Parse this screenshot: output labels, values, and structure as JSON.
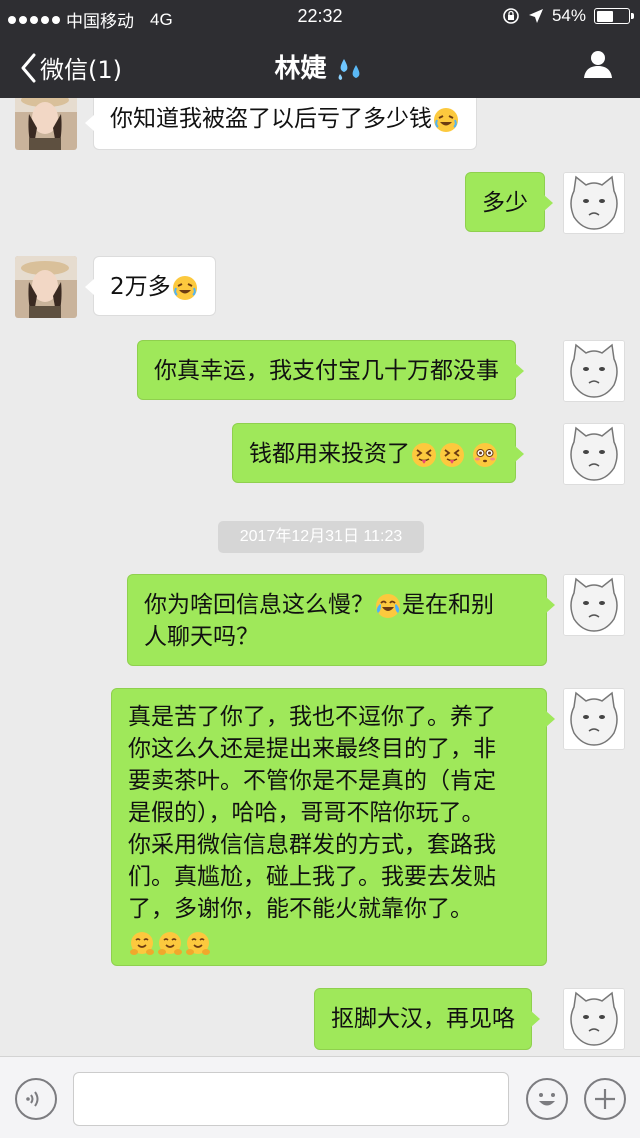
{
  "status_bar": {
    "carrier": "中国移动",
    "network": "4G",
    "time": "22:32",
    "battery": "54%",
    "battery_level": 0.54
  },
  "nav": {
    "back_label": "微信(1)",
    "title": "林婕",
    "title_icon": "sweat-droplets-emoji"
  },
  "messages": [
    {
      "sender": "contact",
      "text": "你知道我被盗了以后亏了多少钱",
      "emojis": [
        "crying-laughing"
      ]
    },
    {
      "sender": "self",
      "text": "多少",
      "emojis": []
    },
    {
      "sender": "contact",
      "text": "2万多",
      "emojis": [
        "crying-laughing"
      ]
    },
    {
      "sender": "self",
      "text": "你真幸运，我支付宝几十万都没事",
      "emojis": []
    },
    {
      "sender": "self",
      "text": "钱都用来投资了",
      "emojis": [
        "squinting-tongue",
        "squinting-tongue",
        "flushed"
      ]
    },
    {
      "sender": "self",
      "text_line1": "你为啥回信息这么慢？",
      "text_line1b": "是在和别",
      "text_line2": "人聊天吗？",
      "emojis": [
        "tears-of-joy"
      ]
    },
    {
      "sender": "self",
      "lines": [
        "真是苦了你了，我也不逗你了。养了",
        "你这么久还是提出来最终目的了，非",
        "要卖茶叶。不管你是不是真的（肯定",
        "是假的），哈哈，哥哥不陪你玩了。",
        "你采用微信信息群发的方式，套路我",
        "们。真尴尬，碰上我了。我要去发贴",
        "了，多谢你，能不能火就靠你了。"
      ],
      "emojis": [
        "hugging",
        "hugging",
        "hugging"
      ]
    },
    {
      "sender": "self",
      "text": "抠脚大汉，再见咯",
      "emojis": []
    }
  ],
  "timestamp": "2017年12月31日  11:23",
  "input": {
    "voice_icon": "voice-icon",
    "emoji_icon": "emoji-icon",
    "plus_icon": "plus-icon"
  },
  "colors": {
    "header": "#2e2e32",
    "background": "#ebebeb",
    "outgoing_bubble": "#9fe85a",
    "incoming_bubble": "#ffffff"
  }
}
